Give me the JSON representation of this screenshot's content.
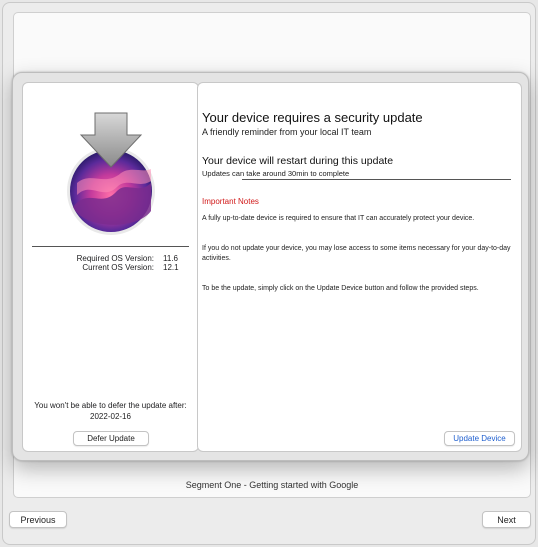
{
  "background": {
    "segment_caption": "Segment One - Getting started with Google"
  },
  "dialog": {
    "left": {
      "icon": "macos-monterey-installer-icon",
      "required_label": "Required OS Version:",
      "required_value": "11.6",
      "current_label": "Current OS Version:",
      "current_value": "12.1",
      "defer_note": "You won't be able to defer the update after:",
      "defer_date": "2022-02-16",
      "defer_button": "Defer Update"
    },
    "right": {
      "title": "Your device requires a security update",
      "subtitle": "A friendly reminder from your local IT team",
      "restart_title": "Your device will restart during this update",
      "restart_sub": "Updates can take around 30min to complete",
      "notes_heading": "Important Notes",
      "paragraphs": [
        "A fully up-to-date device is required to ensure that IT can accurately protect your device.",
        "If you do not update your device, you may lose access to some items necessary for your day-to-day activities.",
        "To be the update, simply click on the Update Device button and follow the provided steps."
      ],
      "update_button": "Update Device"
    }
  },
  "footer": {
    "previous": "Previous",
    "next": "Next"
  },
  "colors": {
    "accent_link": "#1f5fcf",
    "notes_heading": "#d11a1a"
  }
}
